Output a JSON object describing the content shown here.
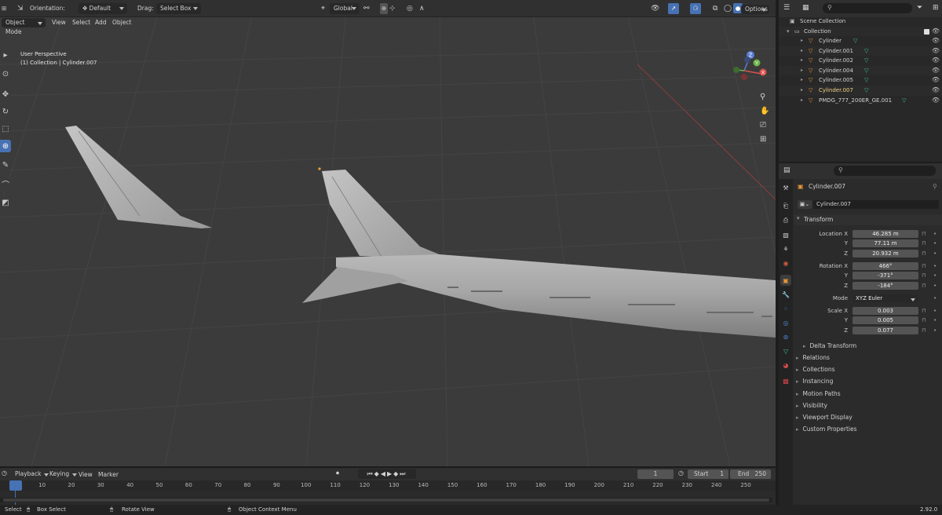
{
  "topbar": {
    "orientation_label": "Orientation:",
    "orientation_value": "Default",
    "drag_label": "Drag:",
    "drag_value": "Select Box",
    "transform_space": "Global",
    "options_label": "Options"
  },
  "menubar": {
    "mode": "Object Mode",
    "items": [
      "View",
      "Select",
      "Add",
      "Object"
    ]
  },
  "viewport": {
    "line1": "User Perspective",
    "line2": "(1) Collection | Cylinder.007",
    "gizmo_z": "Z",
    "gizmo_y": "Y",
    "gizmo_x": "X"
  },
  "outliner": {
    "root": "Scene Collection",
    "collection": "Collection",
    "items": [
      "Cylinder",
      "Cylinder.001",
      "Cylinder.002",
      "Cylinder.004",
      "Cylinder.005",
      "Cylinder.007",
      "PMDG_777_200ER_GE.001"
    ]
  },
  "properties": {
    "object_name": "Cylinder.007",
    "object_field": "Cylinder.007",
    "transform_header": "Transform",
    "location_label": "Location X",
    "location": [
      "46.285 m",
      "77.11 m",
      "20.932 m"
    ],
    "rotation_label": "Rotation X",
    "rotation": [
      "466°",
      "-371°",
      "-184°"
    ],
    "mode_label": "Mode",
    "mode_value": "XYZ Euler",
    "scale_label": "Scale X",
    "scale": [
      "0.003",
      "0.005",
      "0.077"
    ],
    "axis_y": "Y",
    "axis_z": "Z",
    "delta_transform": "Delta Transform",
    "sections": [
      "Relations",
      "Collections",
      "Instancing",
      "Motion Paths",
      "Visibility",
      "Viewport Display",
      "Custom Properties"
    ]
  },
  "timeline": {
    "playback": "Playback",
    "keying": "Keying",
    "view": "View",
    "marker": "Marker",
    "current_frame": "1",
    "start_label": "Start",
    "start_value": "1",
    "end_label": "End",
    "end_value": "250",
    "ruler_ticks": [
      "1",
      "10",
      "20",
      "30",
      "40",
      "50",
      "60",
      "70",
      "80",
      "90",
      "100",
      "110",
      "120",
      "130",
      "140",
      "150",
      "160",
      "170",
      "180",
      "190",
      "200",
      "210",
      "220",
      "230",
      "240",
      "250"
    ]
  },
  "statusbar": {
    "select": "Select",
    "box_select": "Box Select",
    "rotate_view": "Rotate View",
    "context_menu": "Object Context Menu",
    "version": "2.92.0"
  }
}
